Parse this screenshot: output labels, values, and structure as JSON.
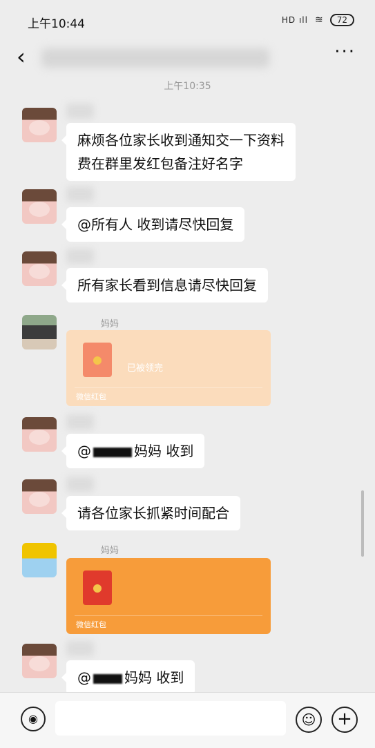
{
  "status_bar": {
    "time": "上午10:44",
    "signal": "HD ıll",
    "wifi": "≋",
    "battery": "72"
  },
  "nav": {
    "back_icon": "‹",
    "title": "",
    "more_icon": "···"
  },
  "time_divider": "上午10:35",
  "messages": [
    {
      "type": "text",
      "sender": "",
      "text": "麻烦各位家长收到通知交一下资料",
      "text_line2": "费在群里发红包备注好名字"
    },
    {
      "type": "text",
      "sender": "",
      "text": "@所有人 收到请尽快回复"
    },
    {
      "type": "text",
      "sender": "",
      "text": "所有家长看到信息请尽快回复"
    },
    {
      "type": "redpacket",
      "sender": "妈妈",
      "status": "已被领完",
      "footer": "微信红包"
    },
    {
      "type": "text",
      "sender": "",
      "prefix": "@",
      "suffix": "妈妈  收到"
    },
    {
      "type": "text",
      "sender": "",
      "text": "请各位家长抓紧时间配合"
    },
    {
      "type": "redpacket",
      "sender": "妈妈",
      "footer": "微信红包"
    },
    {
      "type": "text",
      "sender": "",
      "prefix": "@",
      "suffix": "妈妈  收到"
    }
  ],
  "input_bar": {
    "placeholder": "",
    "voice_icon": "◉",
    "emoji_icon": "☺",
    "plus_icon": "+"
  }
}
